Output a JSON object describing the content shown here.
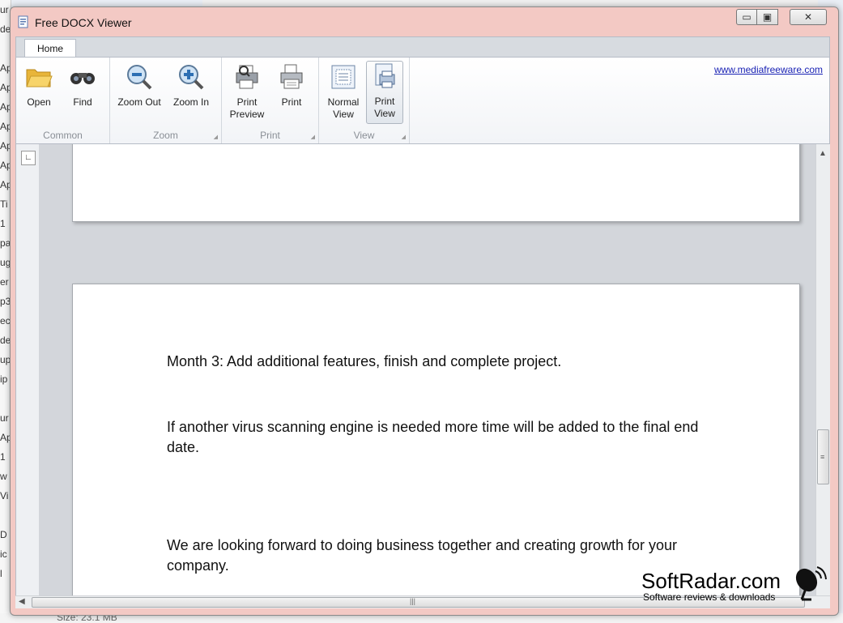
{
  "background": {
    "left_letters": [
      "ur",
      "de",
      "",
      "Ap",
      "Ap",
      "Ap",
      "Ap",
      "Ap",
      "Ap",
      "Ap",
      "Ti",
      "1",
      "pa",
      "ug",
      "er",
      "p3",
      "ec",
      "de",
      "up",
      "ip",
      "",
      "ur",
      "Ap",
      "1",
      "w",
      "Vi",
      "",
      "D",
      "ic",
      "l"
    ],
    "bottom_status": "Size: 23.1 MB"
  },
  "window": {
    "title": "Free DOCX Viewer",
    "min_label": "▭",
    "max_label": "▣",
    "close_label": "✕"
  },
  "ribbon": {
    "tab": "Home",
    "link": "www.mediafreeware.com",
    "groups": {
      "common": {
        "label": "Common",
        "open": "Open",
        "find": "Find"
      },
      "zoom": {
        "label": "Zoom",
        "zoom_out": "Zoom Out",
        "zoom_in": "Zoom In"
      },
      "print": {
        "label": "Print",
        "print_preview_1": "Print",
        "print_preview_2": "Preview",
        "print": "Print"
      },
      "view": {
        "label": "View",
        "normal_1": "Normal",
        "normal_2": "View",
        "printview_1": "Print",
        "printview_2": "View"
      }
    }
  },
  "document": {
    "paragraphs": [
      "Month 3: Add additional features, finish and complete project.",
      "If another virus scanning engine is needed more time will be added to the final end date.",
      "We are looking forward to doing business together and creating growth for your company."
    ]
  },
  "watermark": {
    "title": "SoftRadar.com",
    "subtitle": "Software reviews & downloads"
  },
  "colors": {
    "title_bar": "#f3c9c4",
    "link": "#1a22b4",
    "doc_background": "#d3d6db"
  }
}
